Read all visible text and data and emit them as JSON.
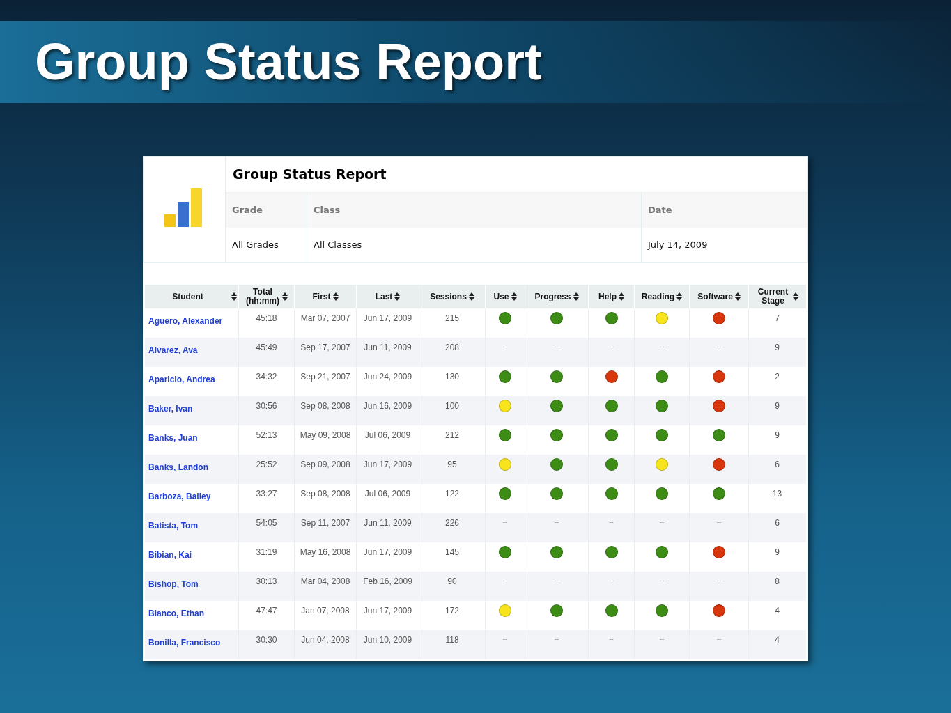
{
  "slide_title": "Group Status Report",
  "report": {
    "title": "Group Status Report",
    "filters": [
      {
        "label": "Grade",
        "value": "All Grades"
      },
      {
        "label": "Class",
        "value": "All Classes"
      },
      {
        "label": "Date",
        "value": "July 14, 2009"
      }
    ],
    "table": {
      "columns": [
        "Student",
        "Total (hh:mm)",
        "First",
        "Last",
        "Sessions",
        "Use",
        "Progress",
        "Help",
        "Reading",
        "Software",
        "Current Stage"
      ],
      "rows": [
        {
          "student": "Aguero, Alexander",
          "total": "45:18",
          "first": "Mar 07, 2007",
          "last": "Jun 17, 2009",
          "sessions": "215",
          "statuses": [
            {
              "kind": "dot",
              "color": "#3d8c16"
            },
            {
              "kind": "dot",
              "color": "#3d8c16"
            },
            {
              "kind": "dot",
              "color": "#3d8c16"
            },
            {
              "kind": "dot",
              "color": "#f7e41c"
            },
            {
              "kind": "dot",
              "color": "#d8360d"
            }
          ],
          "stage": "7"
        },
        {
          "student": "Alvarez, Ava",
          "total": "45:49",
          "first": "Sep 17, 2007",
          "last": "Jun 11, 2009",
          "sessions": "208",
          "statuses": [
            {
              "kind": "text",
              "text": "--"
            },
            {
              "kind": "text",
              "text": "--"
            },
            {
              "kind": "text",
              "text": "--"
            },
            {
              "kind": "text",
              "text": "--"
            },
            {
              "kind": "text",
              "text": "--"
            }
          ],
          "stage": "9"
        },
        {
          "student": "Aparicio, Andrea",
          "total": "34:32",
          "first": "Sep 21, 2007",
          "last": "Jun 24, 2009",
          "sessions": "130",
          "statuses": [
            {
              "kind": "dot",
              "color": "#3d8c16"
            },
            {
              "kind": "dot",
              "color": "#3d8c16"
            },
            {
              "kind": "dot",
              "color": "#d8360d"
            },
            {
              "kind": "dot",
              "color": "#3d8c16"
            },
            {
              "kind": "dot",
              "color": "#d8360d"
            }
          ],
          "stage": "2"
        },
        {
          "student": "Baker, Ivan",
          "total": "30:56",
          "first": "Sep 08, 2008",
          "last": "Jun 16, 2009",
          "sessions": "100",
          "statuses": [
            {
              "kind": "dot",
              "color": "#f7e41c"
            },
            {
              "kind": "dot",
              "color": "#3d8c16"
            },
            {
              "kind": "dot",
              "color": "#3d8c16"
            },
            {
              "kind": "dot",
              "color": "#3d8c16"
            },
            {
              "kind": "dot",
              "color": "#d8360d"
            }
          ],
          "stage": "9"
        },
        {
          "student": "Banks, Juan",
          "total": "52:13",
          "first": "May 09, 2008",
          "last": "Jul 06, 2009",
          "sessions": "212",
          "statuses": [
            {
              "kind": "dot",
              "color": "#3d8c16"
            },
            {
              "kind": "dot",
              "color": "#3d8c16"
            },
            {
              "kind": "dot",
              "color": "#3d8c16"
            },
            {
              "kind": "dot",
              "color": "#3d8c16"
            },
            {
              "kind": "dot",
              "color": "#3d8c16"
            }
          ],
          "stage": "9"
        },
        {
          "student": "Banks, Landon",
          "total": "25:52",
          "first": "Sep 09, 2008",
          "last": "Jun 17, 2009",
          "sessions": "95",
          "statuses": [
            {
              "kind": "dot",
              "color": "#f7e41c"
            },
            {
              "kind": "dot",
              "color": "#3d8c16"
            },
            {
              "kind": "dot",
              "color": "#3d8c16"
            },
            {
              "kind": "dot",
              "color": "#f7e41c"
            },
            {
              "kind": "dot",
              "color": "#d8360d"
            }
          ],
          "stage": "6"
        },
        {
          "student": "Barboza, Bailey",
          "total": "33:27",
          "first": "Sep 08, 2008",
          "last": "Jul 06, 2009",
          "sessions": "122",
          "statuses": [
            {
              "kind": "dot",
              "color": "#3d8c16"
            },
            {
              "kind": "dot",
              "color": "#3d8c16"
            },
            {
              "kind": "dot",
              "color": "#3d8c16"
            },
            {
              "kind": "dot",
              "color": "#3d8c16"
            },
            {
              "kind": "dot",
              "color": "#3d8c16"
            }
          ],
          "stage": "13"
        },
        {
          "student": "Batista, Tom",
          "total": "54:05",
          "first": "Sep 11, 2007",
          "last": "Jun 11, 2009",
          "sessions": "226",
          "statuses": [
            {
              "kind": "text",
              "text": "--"
            },
            {
              "kind": "text",
              "text": "--"
            },
            {
              "kind": "text",
              "text": "--"
            },
            {
              "kind": "text",
              "text": "--"
            },
            {
              "kind": "text",
              "text": "--"
            }
          ],
          "stage": "6"
        },
        {
          "student": "Bibian, Kai",
          "total": "31:19",
          "first": "May 16, 2008",
          "last": "Jun 17, 2009",
          "sessions": "145",
          "statuses": [
            {
              "kind": "dot",
              "color": "#3d8c16"
            },
            {
              "kind": "dot",
              "color": "#3d8c16"
            },
            {
              "kind": "dot",
              "color": "#3d8c16"
            },
            {
              "kind": "dot",
              "color": "#3d8c16"
            },
            {
              "kind": "dot",
              "color": "#d8360d"
            }
          ],
          "stage": "9"
        },
        {
          "student": "Bishop, Tom",
          "total": "30:13",
          "first": "Mar 04, 2008",
          "last": "Feb 16, 2009",
          "sessions": "90",
          "statuses": [
            {
              "kind": "text",
              "text": "--"
            },
            {
              "kind": "text",
              "text": "--"
            },
            {
              "kind": "text",
              "text": "--"
            },
            {
              "kind": "text",
              "text": "--"
            },
            {
              "kind": "text",
              "text": "--"
            }
          ],
          "stage": "8"
        },
        {
          "student": "Blanco, Ethan",
          "total": "47:47",
          "first": "Jan 07, 2008",
          "last": "Jun 17, 2009",
          "sessions": "172",
          "statuses": [
            {
              "kind": "dot",
              "color": "#f7e41c"
            },
            {
              "kind": "dot",
              "color": "#3d8c16"
            },
            {
              "kind": "dot",
              "color": "#3d8c16"
            },
            {
              "kind": "dot",
              "color": "#3d8c16"
            },
            {
              "kind": "dot",
              "color": "#d8360d"
            }
          ],
          "stage": "4"
        },
        {
          "student": "Bonilla, Francisco",
          "total": "30:30",
          "first": "Jun 04, 2008",
          "last": "Jun 10, 2009",
          "sessions": "118",
          "statuses": [
            {
              "kind": "text",
              "text": "--"
            },
            {
              "kind": "text",
              "text": "--"
            },
            {
              "kind": "text",
              "text": "--"
            },
            {
              "kind": "text",
              "text": "--"
            },
            {
              "kind": "text",
              "text": "--"
            }
          ],
          "stage": "4"
        }
      ]
    }
  }
}
